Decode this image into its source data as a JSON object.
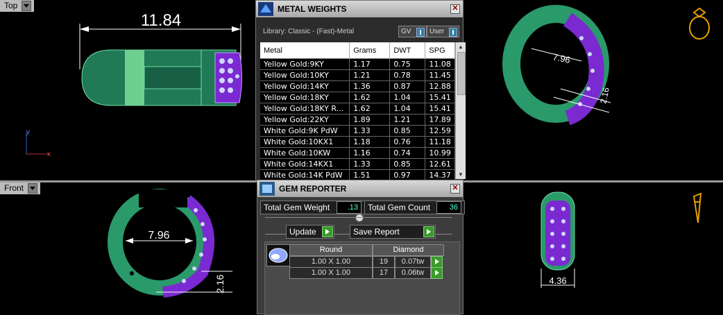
{
  "viewports": {
    "top": {
      "label": "Top",
      "dimension": "11.84",
      "axis_y": "y",
      "axis_x": "x"
    },
    "front": {
      "label": "Front",
      "dimension_width": "7.96",
      "dimension_height": "2.16"
    },
    "perspective": {
      "dimension_width": "7.96",
      "dimension_height": "2.16"
    },
    "side": {
      "dimension_width": "4.36"
    }
  },
  "metal_weights": {
    "title": "METAL WEIGHTS",
    "library": "Library: Classic - (Fast)-Metal",
    "toggle_gv": "GV",
    "toggle_user": "User",
    "columns": [
      "Metal",
      "Grams",
      "DWT",
      "SPG"
    ],
    "rows": [
      [
        "Yellow Gold:9KY",
        "1.17",
        "0.75",
        "11.08"
      ],
      [
        "Yellow Gold:10KY",
        "1.21",
        "0.78",
        "11.45"
      ],
      [
        "Yellow Gold:14KY",
        "1.36",
        "0.87",
        "12.88"
      ],
      [
        "Yellow Gold:18KY",
        "1.62",
        "1.04",
        "15.41"
      ],
      [
        "Yellow Gold:18KY R...",
        "1.62",
        "1.04",
        "15.41"
      ],
      [
        "Yellow Gold:22KY",
        "1.89",
        "1.21",
        "17.89"
      ],
      [
        "White Gold:9K PdW",
        "1.33",
        "0.85",
        "12.59"
      ],
      [
        "White Gold:10KX1",
        "1.18",
        "0.76",
        "11.18"
      ],
      [
        "White Gold:10KW",
        "1.16",
        "0.74",
        "10.99"
      ],
      [
        "White Gold:14KX1",
        "1.33",
        "0.85",
        "12.61"
      ],
      [
        "White Gold:14K PdW",
        "1.51",
        "0.97",
        "14.37"
      ]
    ]
  },
  "gem_reporter": {
    "title": "GEM REPORTER",
    "total_weight_label": "Total Gem Weight",
    "total_weight_value": ".13",
    "total_count_label": "Total Gem Count",
    "total_count_value": "36",
    "update_label": "Update",
    "save_report_label": "Save Report",
    "shape_header": "Round",
    "type_header": "Diamond",
    "rows": [
      {
        "size": "1.00 X 1.00",
        "count": "19",
        "weight": "0.07tw"
      },
      {
        "size": "1.00 X 1.00",
        "count": "17",
        "weight": "0.06tw"
      }
    ]
  }
}
